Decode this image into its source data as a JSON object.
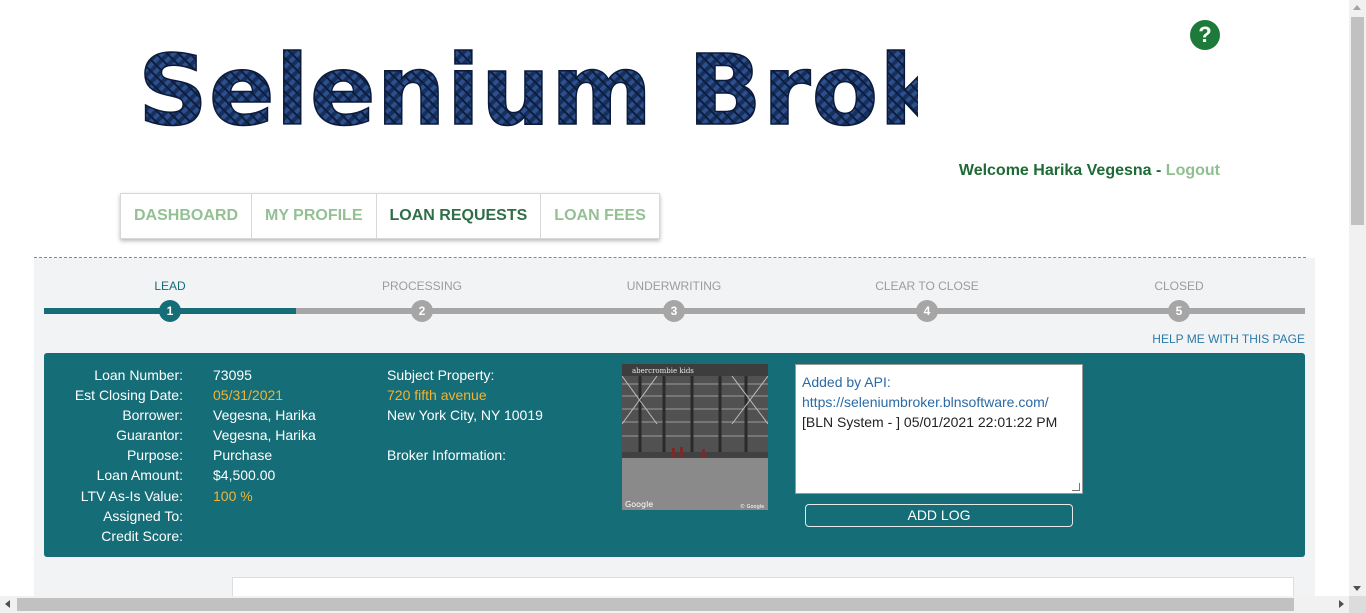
{
  "header": {
    "logo_text": "Selenium Broker",
    "help_icon": "question-icon",
    "welcome_prefix": "Welcome Harika Vegesna - ",
    "logout_label": "Logout"
  },
  "nav": {
    "items": [
      {
        "label": "DASHBOARD",
        "active": false
      },
      {
        "label": "MY PROFILE",
        "active": false
      },
      {
        "label": "LOAN REQUESTS",
        "active": true
      },
      {
        "label": "LOAN FEES",
        "active": false
      }
    ]
  },
  "progress": {
    "steps": [
      {
        "label": "LEAD",
        "number": "1"
      },
      {
        "label": "PROCESSING",
        "number": "2"
      },
      {
        "label": "UNDERWRITING",
        "number": "3"
      },
      {
        "label": "CLEAR TO CLOSE",
        "number": "4"
      },
      {
        "label": "CLOSED",
        "number": "5"
      }
    ],
    "current_step": 1
  },
  "help_link": "HELP ME WITH THIS PAGE",
  "loan": {
    "fields": [
      {
        "label": "Loan Number:",
        "value": "73095",
        "highlight": false
      },
      {
        "label": "Est Closing Date:",
        "value": " 05/31/2021",
        "highlight": true
      },
      {
        "label": "Borrower:",
        "value": "Vegesna, Harika",
        "highlight": false
      },
      {
        "label": "Guarantor:",
        "value": "Vegesna, Harika",
        "highlight": false
      },
      {
        "label": "Purpose:",
        "value": "Purchase",
        "highlight": false
      },
      {
        "label": "Loan Amount:",
        "value": "$4,500.00",
        "highlight": false
      },
      {
        "label": "LTV As-Is Value:",
        "value": "100 %",
        "highlight": true
      },
      {
        "label": "Assigned To:",
        "value": "",
        "highlight": false
      },
      {
        "label": "Credit Score:",
        "value": "",
        "highlight": false
      }
    ],
    "subject_property_label": "Subject Property:",
    "subject_address_line1": "720 fifth avenue",
    "subject_address_line2": "New York City, NY 10019",
    "broker_info_label": "Broker Information:",
    "photo_sign_text": "abercrombie kids",
    "photo_watermark": "Google",
    "photo_copyright": "© Google"
  },
  "log": {
    "line1": "Added by API:",
    "line2": "https://seleniumbroker.blnsoftware.com/",
    "line3": "[BLN System - ] 05/01/2021 22:01:22 PM",
    "add_button": "ADD LOG"
  },
  "colors": {
    "teal": "#146d77",
    "orange": "#f5b330",
    "green": "#1e7a3b",
    "nav_inactive": "#93c194",
    "nav_active": "#2f6e47"
  }
}
